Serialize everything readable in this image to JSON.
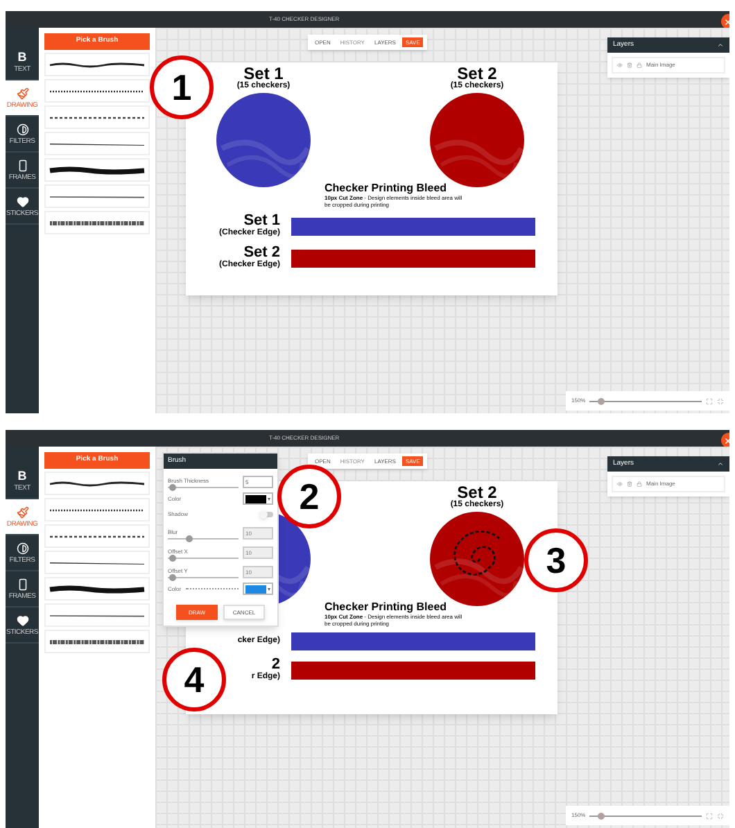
{
  "panels": [
    {
      "title": "T-40 CHECKER DESIGNER",
      "sidebar": [
        {
          "kind": "letter",
          "glyph": "B",
          "label": "TEXT",
          "selected": false
        },
        {
          "kind": "brush",
          "label": "DRAWING",
          "selected": true
        },
        {
          "kind": "contrast",
          "label": "FILTERS",
          "selected": false
        },
        {
          "kind": "frame",
          "label": "FRAMES",
          "selected": false
        },
        {
          "kind": "heart",
          "label": "STICKERS",
          "selected": false
        }
      ],
      "brush_header": "Pick a Brush",
      "brushes": [
        {
          "kind": "wavy"
        },
        {
          "kind": "dotted"
        },
        {
          "kind": "dashed"
        },
        {
          "kind": "taper"
        },
        {
          "kind": "thick"
        },
        {
          "kind": "fine"
        },
        {
          "kind": "rough"
        }
      ],
      "toolbar": [
        {
          "label": "OPEN",
          "kind": "plain"
        },
        {
          "label": "HISTORY",
          "kind": "muted"
        },
        {
          "label": "LAYERS",
          "kind": "plain"
        },
        {
          "label": "SAVE",
          "kind": "primary"
        }
      ],
      "canvas": {
        "sets": [
          {
            "title": "Set 1",
            "subtitle": "(15 checkers)",
            "color": "#3a3ab8",
            "spiral": false
          },
          {
            "title": "Set 2",
            "subtitle": "(15 checkers)",
            "color": "#b00000",
            "spiral": false
          }
        ],
        "bleed_title": "Checker Printing Bleed",
        "bleed_note": "**10px Cut Zone** - Design elements inside bleed area will be cropped during printing",
        "rows": [
          {
            "label": "Set 1",
            "sublabel": "(Checker Edge)",
            "color": "#3a3ab8"
          },
          {
            "label": "Set 2",
            "sublabel": "(Checker Edge)",
            "color": "#b00000"
          }
        ]
      },
      "layers": {
        "title": "Layers",
        "items": [
          {
            "name": "Main Image"
          }
        ]
      },
      "zoom": {
        "reading": "150%",
        "level": 0.1
      },
      "callouts": [
        "1"
      ]
    },
    {
      "title": "T-40 CHECKER DESIGNER",
      "sidebar": [
        {
          "kind": "letter",
          "glyph": "B",
          "label": "TEXT",
          "selected": false
        },
        {
          "kind": "brush",
          "label": "DRAWING",
          "selected": true
        },
        {
          "kind": "contrast",
          "label": "FILTERS",
          "selected": false
        },
        {
          "kind": "frame",
          "label": "FRAMES",
          "selected": false
        },
        {
          "kind": "heart",
          "label": "STICKERS",
          "selected": false
        }
      ],
      "brush_header": "Pick a Brush",
      "brushes": [
        {
          "kind": "wavy"
        },
        {
          "kind": "dotted"
        },
        {
          "kind": "dashed"
        },
        {
          "kind": "taper"
        },
        {
          "kind": "thick"
        },
        {
          "kind": "fine"
        },
        {
          "kind": "rough"
        }
      ],
      "toolbar": [
        {
          "label": "OPEN",
          "kind": "plain"
        },
        {
          "label": "HISTORY",
          "kind": "muted"
        },
        {
          "label": "LAYERS",
          "kind": "plain"
        },
        {
          "label": "SAVE",
          "kind": "primary"
        }
      ],
      "canvas": {
        "sets": [
          {
            "color": "#3a3ab8",
            "spiral": false
          },
          {
            "title": "Set 2",
            "subtitle": "(15 checkers)",
            "color": "#b00000",
            "spiral": true
          }
        ],
        "bleed_title": "Checker Printing Bleed",
        "bleed_note": "**10px Cut Zone** - Design elements inside bleed area will be cropped during printing",
        "rows": [
          {
            "sublabel": "cker Edge)",
            "color": "#3a3ab8"
          },
          {
            "label": "2",
            "sublabel": "r Edge)",
            "color": "#b00000"
          }
        ]
      },
      "layers": {
        "title": "Layers",
        "items": [
          {
            "name": "Main Image"
          }
        ]
      },
      "zoom": {
        "reading": "150%",
        "level": 0.1
      },
      "dialog": {
        "title": "Brush",
        "rows": [
          {
            "kind": "slider",
            "label": "Brush Thickness",
            "level": 0.05,
            "value": "5",
            "disabled": false
          },
          {
            "kind": "color",
            "label": "Color",
            "color": "#000000"
          },
          {
            "kind": "toggle",
            "label": "Shadow",
            "on": false
          },
          {
            "kind": "slider",
            "label": "Blur",
            "level": 0.3,
            "value": "10",
            "disabled": true
          },
          {
            "kind": "slider",
            "label": "Offset X",
            "level": 0.05,
            "value": "10",
            "disabled": true
          },
          {
            "kind": "slider",
            "label": "Offset Y",
            "level": 0.05,
            "value": "10",
            "disabled": true
          },
          {
            "kind": "dotcolor",
            "label": "Color",
            "color": "#1e88e5"
          }
        ],
        "buttons": [
          {
            "label": "DRAW",
            "kind": "primary"
          },
          {
            "label": "CANCEL",
            "kind": "secondary"
          }
        ]
      },
      "callouts": [
        "2",
        "3",
        "4"
      ]
    }
  ]
}
